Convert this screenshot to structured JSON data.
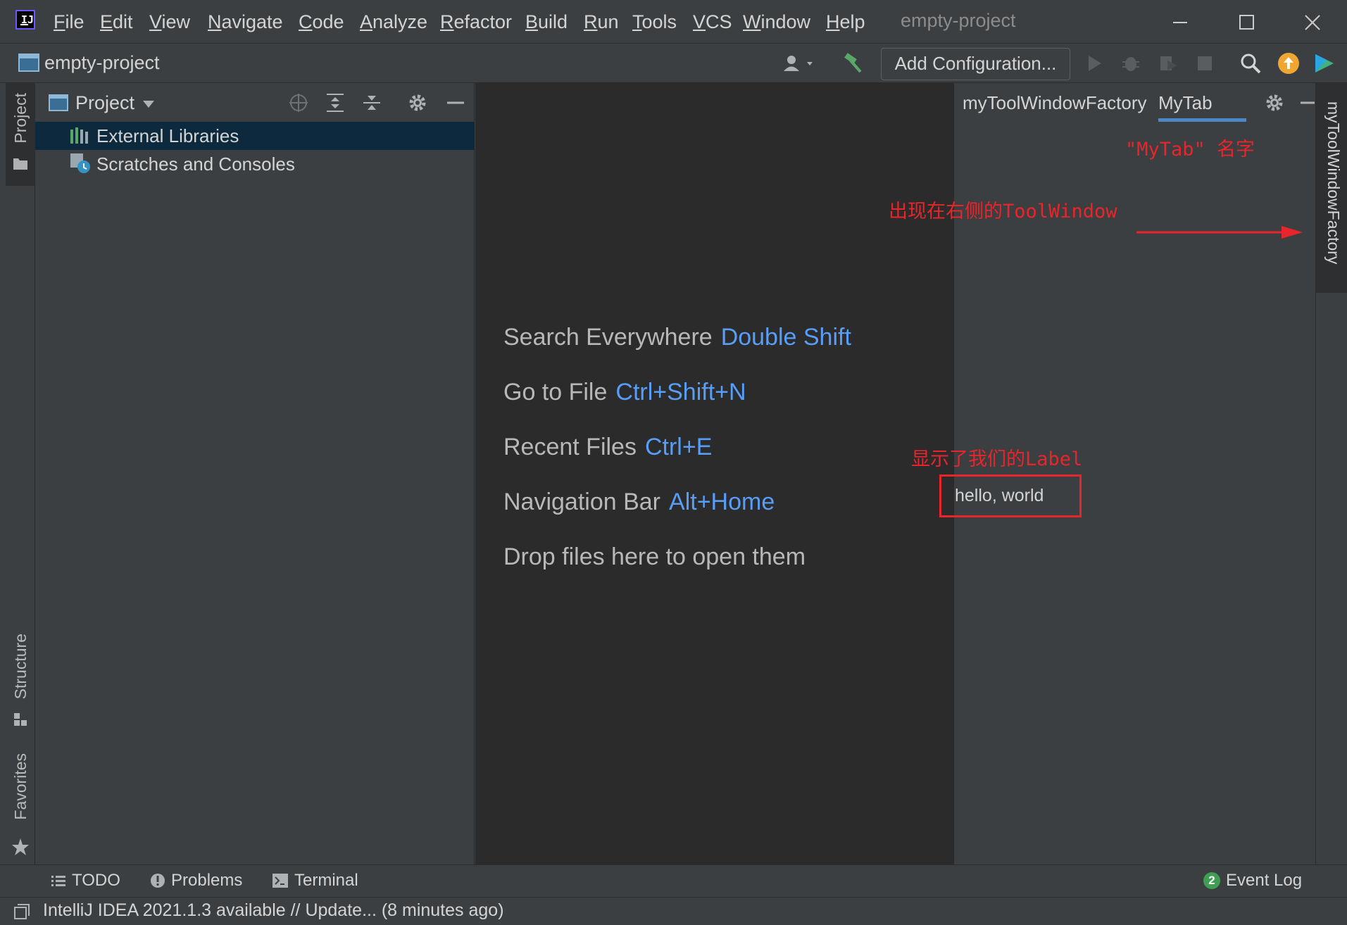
{
  "app": {
    "window_title": "empty-project",
    "menu": [
      "File",
      "Edit",
      "View",
      "Navigate",
      "Code",
      "Analyze",
      "Refactor",
      "Build",
      "Run",
      "Tools",
      "VCS",
      "Window",
      "Help"
    ]
  },
  "navbar": {
    "breadcrumb": "empty-project",
    "add_configuration": "Add Configuration..."
  },
  "left_stripe": {
    "project": "Project",
    "structure": "Structure",
    "favorites": "Favorites"
  },
  "project_panel": {
    "title": "Project",
    "items": [
      {
        "label": "External Libraries",
        "icon": "library-icon",
        "selected": true
      },
      {
        "label": "Scratches and Consoles",
        "icon": "scratches-icon",
        "selected": false
      }
    ]
  },
  "editor": {
    "hints": [
      {
        "label": "Search Everywhere",
        "shortcut": "Double Shift"
      },
      {
        "label": "Go to File",
        "shortcut": "Ctrl+Shift+N"
      },
      {
        "label": "Recent Files",
        "shortcut": "Ctrl+E"
      },
      {
        "label": "Navigation Bar",
        "shortcut": "Alt+Home"
      }
    ],
    "drop_text": "Drop files here to open them"
  },
  "tool_window": {
    "tabs": [
      "myToolWindowFactory",
      "MyTab"
    ],
    "active_tab": "MyTab",
    "label_text": "hello, world"
  },
  "right_stripe": {
    "label": "myToolWindowFactory"
  },
  "bottom_tools": {
    "todo": "TODO",
    "problems": "Problems",
    "terminal": "Terminal",
    "event_log": "Event Log",
    "event_log_count": "2"
  },
  "status": {
    "text": "IntelliJ IDEA 2021.1.3 available // Update... (8 minutes ago)"
  },
  "annotations": {
    "tab_name": "\"MyTab\" 名字",
    "right_toolwindow": "出现在右侧的ToolWindow",
    "label_shown": "显示了我们的Label"
  },
  "colors": {
    "background": "#3c3f41",
    "editor": "#2b2b2b",
    "accent_blue": "#589df6",
    "selection": "#0d293e",
    "annotation_red": "#e8252a"
  }
}
